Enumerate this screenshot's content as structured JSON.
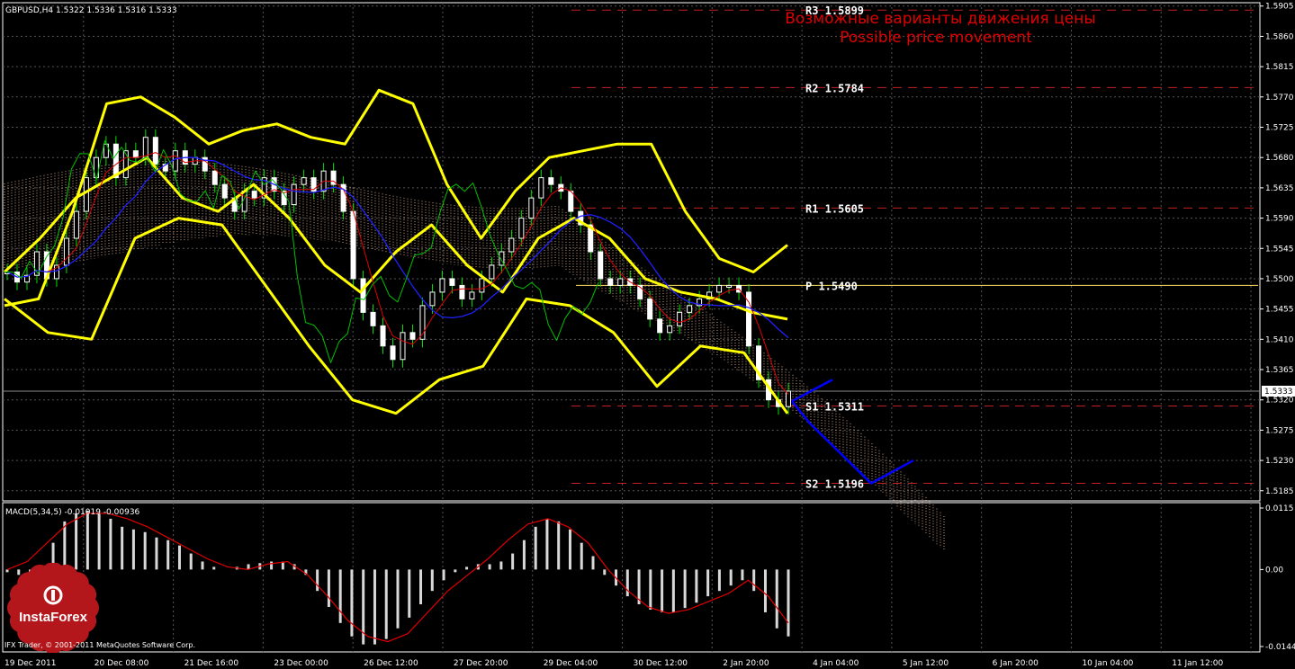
{
  "window": {
    "title": "GBPUSD,H4  1.5322 1.5336 1.5316 1.5333"
  },
  "annotation": {
    "line1": "Возможные варианты движения цены",
    "line2": "Possible price movement"
  },
  "current_price": "1.5333",
  "macd": {
    "label": "MACD(5,34,5) -0.01019 -0.00936"
  },
  "branding": {
    "logo_text": "InstaForex",
    "logo_icon": "gear-flower-icon",
    "copyright": "IFX Trader, © 2001-2011 MetaQuotes Software Corp."
  },
  "colors": {
    "candle_up": "#ffffff",
    "candle_down": "#ffffff",
    "wick": "#00e000",
    "bollinger": "#ffff00",
    "tenkan": "#e00000",
    "kijun": "#2020ff",
    "chikou": "#00c000",
    "cloud": "#ffc8a0",
    "forecast": "#0000ff",
    "pivot_dashed": "#c02020",
    "pivot_p": "#ffdd66"
  },
  "chart_data": {
    "type": "candlestick",
    "symbol": "GBPUSD",
    "timeframe": "H4",
    "ylim": [
      1.517,
      1.591
    ],
    "price_ticks": [
      "1.5905",
      "1.5860",
      "1.5815",
      "1.5770",
      "1.5725",
      "1.5680",
      "1.5635",
      "1.5590",
      "1.5545",
      "1.5500",
      "1.5455",
      "1.5410",
      "1.5365",
      "1.5320",
      "1.5275",
      "1.5230",
      "1.5185"
    ],
    "time_labels": [
      "19 Dec 2011",
      "20 Dec 08:00",
      "21 Dec 16:00",
      "23 Dec 00:00",
      "26 Dec 12:00",
      "27 Dec 20:00",
      "29 Dec 04:00",
      "30 Dec 12:00",
      "2 Jan 20:00",
      "4 Jan 04:00",
      "5 Jan 12:00",
      "6 Jan 20:00",
      "10 Jan 04:00",
      "11 Jan 12:00"
    ],
    "pivots": [
      {
        "name": "R3",
        "label": "R3 1.5899",
        "value": 1.5899
      },
      {
        "name": "R2",
        "label": "R2 1.5784",
        "value": 1.5784
      },
      {
        "name": "R1",
        "label": "R1 1.5605",
        "value": 1.5605
      },
      {
        "name": "P",
        "label": "P 1.5490",
        "value": 1.549
      },
      {
        "name": "S1",
        "label": "S1 1.5311",
        "value": 1.5311
      },
      {
        "name": "S2",
        "label": "S2 1.5196",
        "value": 1.5196
      }
    ],
    "macd_ticks": [
      "0.0115",
      "0.00",
      "-0.0144"
    ],
    "closes": [
      1.551,
      1.5495,
      1.5505,
      1.554,
      1.55,
      1.552,
      1.556,
      1.56,
      1.565,
      1.568,
      1.57,
      1.565,
      1.569,
      1.568,
      1.571,
      1.567,
      1.566,
      1.569,
      1.567,
      1.568,
      1.566,
      1.564,
      1.562,
      1.56,
      1.563,
      1.562,
      1.565,
      1.563,
      1.561,
      1.564,
      1.565,
      1.563,
      1.566,
      1.564,
      1.56,
      1.55,
      1.545,
      1.543,
      1.54,
      1.538,
      1.542,
      1.541,
      1.546,
      1.548,
      1.55,
      1.549,
      1.547,
      1.548,
      1.55,
      1.552,
      1.554,
      1.556,
      1.559,
      1.562,
      1.565,
      1.564,
      1.563,
      1.56,
      1.558,
      1.554,
      1.55,
      1.549,
      1.55,
      1.549,
      1.547,
      1.544,
      1.542,
      1.543,
      1.545,
      1.546,
      1.547,
      1.548,
      1.549,
      1.549,
      1.548,
      1.54,
      1.535,
      1.532,
      1.531,
      1.5333
    ],
    "bollinger_upper": [
      1.546,
      1.547,
      1.56,
      1.576,
      1.577,
      1.574,
      1.57,
      1.572,
      1.573,
      1.571,
      1.57,
      1.578,
      1.576,
      1.564,
      1.556,
      1.563,
      1.568,
      1.569,
      1.57,
      1.57,
      1.56,
      1.553,
      1.551,
      1.555
    ],
    "bollinger_middle": [
      1.551,
      1.556,
      1.562,
      1.565,
      1.568,
      1.562,
      1.56,
      1.564,
      1.559,
      1.552,
      1.548,
      1.554,
      1.558,
      1.552,
      1.548,
      1.556,
      1.559,
      1.556,
      1.55,
      1.548,
      1.547,
      1.545,
      1.544
    ],
    "bollinger_lower": [
      1.547,
      1.542,
      1.541,
      1.556,
      1.559,
      1.558,
      1.549,
      1.54,
      1.532,
      1.53,
      1.535,
      1.537,
      1.547,
      1.546,
      1.542,
      1.534,
      1.54,
      1.539,
      1.53
    ],
    "forecast_path": [
      [
        1.5318,
        1.535
      ],
      [
        1.5318,
        1.5285,
        1.5196,
        1.523
      ]
    ],
    "macd_histogram": [
      -0.0005,
      -0.001,
      -0.0008,
      0.0005,
      0.005,
      0.009,
      0.0105,
      0.011,
      0.0105,
      0.0095,
      0.008,
      0.0075,
      0.007,
      0.006,
      0.0055,
      0.0045,
      0.003,
      0.0015,
      0.0005,
      0.0,
      0.0005,
      0.001,
      0.0012,
      0.0015,
      0.0015,
      0.001,
      -0.001,
      -0.004,
      -0.007,
      -0.01,
      -0.0125,
      -0.014,
      -0.014,
      -0.013,
      -0.011,
      -0.009,
      -0.0065,
      -0.004,
      -0.002,
      -0.0005,
      0.0005,
      0.001,
      0.001,
      0.0015,
      0.003,
      0.0055,
      0.008,
      0.0095,
      0.009,
      0.0075,
      0.005,
      0.0025,
      -0.001,
      -0.003,
      -0.005,
      -0.0065,
      -0.0075,
      -0.008,
      -0.008,
      -0.0072,
      -0.0062,
      -0.005,
      -0.004,
      -0.003,
      -0.002,
      -0.004,
      -0.008,
      -0.011,
      -0.0125
    ],
    "macd_signal": [
      0.0,
      0.0015,
      0.005,
      0.0085,
      0.0105,
      0.0105,
      0.0095,
      0.008,
      0.006,
      0.004,
      0.002,
      0.0005,
      0.0,
      0.001,
      0.0015,
      -0.001,
      -0.005,
      -0.0095,
      -0.0125,
      -0.0135,
      -0.012,
      -0.008,
      -0.004,
      -0.001,
      0.002,
      0.0055,
      0.0085,
      0.0095,
      0.008,
      0.005,
      0.0,
      -0.004,
      -0.007,
      -0.0082,
      -0.0075,
      -0.006,
      -0.0045,
      -0.002,
      -0.005,
      -0.01
    ]
  }
}
